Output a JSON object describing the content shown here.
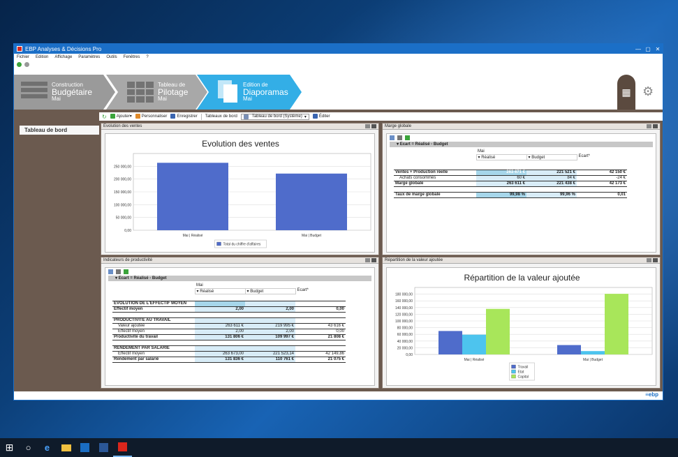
{
  "window": {
    "title": "EBP Analyses & Décisions Pro"
  },
  "menu": [
    "Fichier",
    "Edition",
    "Affichage",
    "Paramètres",
    "Outils",
    "Fenêtres",
    "?"
  ],
  "steps": [
    {
      "small": "Construction",
      "big": "Budgétaire",
      "sub": "Mai"
    },
    {
      "small": "Tableau de",
      "big": "Pilotage",
      "sub": "Mai"
    },
    {
      "small": "Edition de",
      "big": "Diaporamas",
      "sub": "Mai"
    }
  ],
  "sidebar": {
    "item": "Tableau de bord"
  },
  "toolbar": {
    "add": "Ajouter",
    "customize": "Personnaliser",
    "save": "Enregistrer",
    "dashboards": "Tableaux de bord",
    "select": "Tableau de bord (Système)",
    "edit": "Éditer"
  },
  "panels": {
    "ventes": {
      "header": "Evolution des ventes"
    },
    "marge": {
      "header": "Marge globale"
    },
    "productivite": {
      "header": "Indicateurs de productivité"
    },
    "repartition": {
      "header": "Répartition de la valeur ajoutée"
    }
  },
  "chart_data": [
    {
      "type": "bar",
      "title": "Evolution des ventes",
      "categories": [
        "Mai | Réalisé",
        "Mai | Budget"
      ],
      "series": [
        {
          "name": "Total du chiffre d'affaires",
          "values": [
            263671,
            221521
          ],
          "color": "#4f6ccb"
        }
      ],
      "yticks": [
        "0,00",
        "50 000,00",
        "100 000,00",
        "150 000,00",
        "200 000,00",
        "250 000,00"
      ],
      "ylim": [
        0,
        300000
      ],
      "legend": "bottom",
      "grid": true
    },
    {
      "type": "bar",
      "title": "Répartition de la valeur ajoutée",
      "categories": [
        "Mai | Réalisé",
        "Mai | Budget"
      ],
      "series": [
        {
          "name": "Travail",
          "values": [
            70000,
            28000
          ],
          "color": "#4f6ccb"
        },
        {
          "name": "Etat",
          "values": [
            59000,
            10000
          ],
          "color": "#4dc4ee"
        },
        {
          "name": "Capital",
          "values": [
            136000,
            181000
          ],
          "color": "#a8e65a"
        }
      ],
      "yticks": [
        "0,00",
        "20 000,00",
        "40 000,00",
        "60 000,00",
        "80 000,00",
        "100 000,00",
        "120 000,00",
        "140 000,00",
        "160 000,00",
        "180 000,00"
      ],
      "ylim": [
        0,
        200000
      ],
      "legend": "bottom",
      "grid": true
    }
  ],
  "marge": {
    "ecart": "Ecart = Réalisé - Budget",
    "period": "Mai",
    "col_realise": "Réalisé",
    "col_budget": "Budget",
    "col_ecart": "Ecart*",
    "rows": [
      {
        "label": "Ventes + Production réelle",
        "r": "263 671 €",
        "b": "221 521 €",
        "e": "42 150 €",
        "bold": true
      },
      {
        "label": "Achats consommés",
        "r": "60 €",
        "b": "84 €",
        "e": "-24 €",
        "bold": false
      },
      {
        "label": "Marge globale",
        "r": "263 611 €",
        "b": "221 438 €",
        "e": "42 173 €",
        "bold": true
      }
    ],
    "taux": {
      "label": "Taux de marge globale",
      "r": "99,98 %",
      "b": "99,96 %",
      "e": "0,01"
    }
  },
  "prod": {
    "ecart": "Ecart = Réalisé - Budget",
    "period": "Mai",
    "col_realise": "Réalisé",
    "col_budget": "Budget",
    "col_ecart": "Ecart*",
    "sections": [
      {
        "title": "EVOLUTION DE L'EFFECTIF MOYEN",
        "rows": [
          {
            "label": "Effectif moyen",
            "r": "2,00",
            "b": "2,00",
            "e": "0,00",
            "bold": true
          }
        ]
      },
      {
        "title": "PRODUCTIVITE AU TRAVAIL",
        "rows": [
          {
            "label": "Valeur ajoutée",
            "r": "263 611 €",
            "b": "219 995 €",
            "e": "43 616 €",
            "bold": false
          },
          {
            "label": "Effectif moyen",
            "r": "2,00",
            "b": "2,00",
            "e": "0,00",
            "bold": false
          },
          {
            "label": "Productivité du travail",
            "r": "131 806 €",
            "b": "109 997 €",
            "e": "21 808 €",
            "bold": true
          }
        ]
      },
      {
        "title": "RENDEMENT PAR SALARIE",
        "rows": [
          {
            "label": "Effectif moyen",
            "r": "263 673,00",
            "b": "221 523,14",
            "e": "42 149,86",
            "bold": false
          },
          {
            "label": "Rendement par salarié",
            "r": "131 836 €",
            "b": "110 761 €",
            "e": "21 075 €",
            "bold": true
          }
        ]
      }
    ]
  },
  "status": {
    "brand": "≡ebp"
  }
}
